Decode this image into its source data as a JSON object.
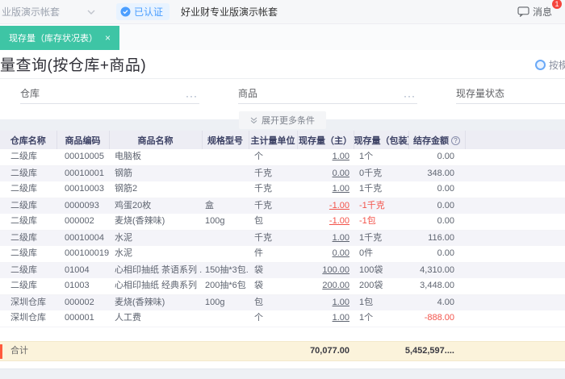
{
  "colors": {
    "accent_teal": "#3ec5a5",
    "link_blue": "#4a9eff",
    "negative_red": "#f3534a",
    "footer_bg": "#fbf3db"
  },
  "topbar": {
    "account_selector": "业版演示帐套",
    "verified_badge": "已认证",
    "company_name": "好业财专业版演示帐套",
    "messages_label": "消息",
    "messages_count": "1"
  },
  "tab": {
    "label": "现存量（库存状况表）",
    "close": "×"
  },
  "page": {
    "title": "量查询(按仓库+商品)",
    "template_button": "按模板"
  },
  "filters": {
    "fields": [
      {
        "label": "仓库",
        "value": "",
        "picker": "···"
      },
      {
        "label": "商品",
        "value": "",
        "picker": "···"
      },
      {
        "label": "现存量状态",
        "value": "",
        "picker": ""
      }
    ],
    "expand_button": "展开更多条件"
  },
  "table": {
    "columns": [
      "仓库名称",
      "商品编码",
      "商品名称",
      "规格型号",
      "主计量单位",
      "现存量（主）",
      "现存量（包装）",
      "结存金额"
    ],
    "help_icon": "?",
    "rows": [
      {
        "warehouse": "二级库",
        "code": "00010005",
        "name": "电脑板",
        "spec": "",
        "unit": "个",
        "qty": "1.00",
        "pkg": "1个",
        "amount": "0.00"
      },
      {
        "warehouse": "二级库",
        "code": "00010001",
        "name": "钢筋",
        "spec": "",
        "unit": "千克",
        "qty": "0.00",
        "pkg": "0千克",
        "amount": "348.00"
      },
      {
        "warehouse": "二级库",
        "code": "00010003",
        "name": "钢筋2",
        "spec": "",
        "unit": "千克",
        "qty": "1.00",
        "pkg": "1千克",
        "amount": "0.00"
      },
      {
        "warehouse": "二级库",
        "code": "0000093",
        "name": "鸡蛋20枚",
        "spec": "盒",
        "unit": "千克",
        "qty": "-1.00",
        "pkg": "-1千克",
        "amount": "0.00"
      },
      {
        "warehouse": "二级库",
        "code": "000002",
        "name": "麦烧(香辣味)",
        "spec": "100g",
        "unit": "包",
        "qty": "-1.00",
        "pkg": "-1包",
        "amount": "0.00"
      },
      {
        "warehouse": "二级库",
        "code": "00010004",
        "name": "水泥",
        "spec": "",
        "unit": "千克",
        "qty": "1.00",
        "pkg": "1千克",
        "amount": "116.00"
      },
      {
        "warehouse": "二级库",
        "code": "000100019",
        "name": "水泥",
        "spec": "",
        "unit": "件",
        "qty": "0.00",
        "pkg": "0件",
        "amount": "0.00"
      },
      {
        "warehouse": "二级库",
        "code": "01004",
        "name": "心相印抽纸 茶语系列 ...",
        "spec": "150抽*3包...",
        "unit": "袋",
        "qty": "100.00",
        "pkg": "100袋",
        "amount": "4,310.00"
      },
      {
        "warehouse": "二级库",
        "code": "01003",
        "name": "心相印抽纸 经典系列",
        "spec": "200抽*6包",
        "unit": "袋",
        "qty": "200.00",
        "pkg": "200袋",
        "amount": "3,448.00"
      },
      {
        "warehouse": "深圳仓库",
        "code": "000002",
        "name": "麦烧(香辣味)",
        "spec": "100g",
        "unit": "包",
        "qty": "1.00",
        "pkg": "1包",
        "amount": "4.00"
      },
      {
        "warehouse": "深圳仓库",
        "code": "000001",
        "name": "人工费",
        "spec": "",
        "unit": "个",
        "qty": "1.00",
        "pkg": "1个",
        "amount": "-888.00"
      }
    ],
    "footer": {
      "label": "合计",
      "qty_total": "70,077.00",
      "amount_total": "5,452,597...."
    }
  }
}
